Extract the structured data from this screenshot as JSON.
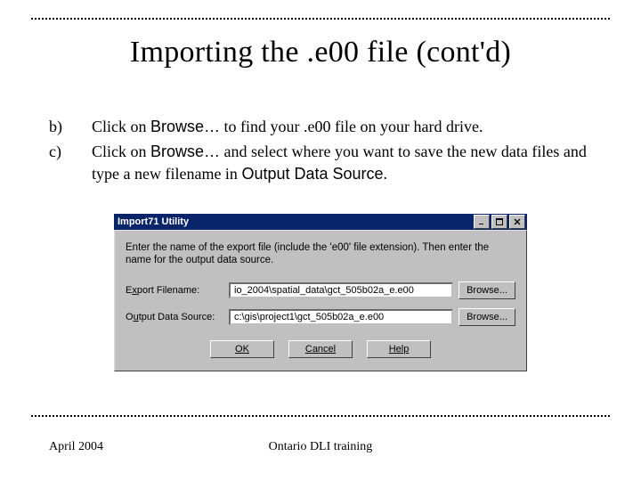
{
  "title": "Importing the .e00 file (cont'd)",
  "steps": {
    "b": {
      "letter": "b)",
      "pre": "Click on ",
      "cmd": "Browse…",
      "post": " to find your .e00 file on your hard drive."
    },
    "c": {
      "letter": "c)",
      "pre": "Click on ",
      "cmd": "Browse…",
      "mid": " and select where you want to save the new data files and type a new filename in ",
      "post_cmd": "Output Data Source",
      "end": "."
    }
  },
  "dialog": {
    "caption": "Import71 Utility",
    "instruction": "Enter the name of the export file (include the 'e00' file extension). Then enter the name for the output data source.",
    "fields": {
      "export": {
        "label_pre": "E",
        "label_hot": "x",
        "label_post": "port Filename:",
        "value": "io_2004\\spatial_data\\gct_505b02a_e.e00"
      },
      "output": {
        "label_pre": "O",
        "label_hot": "u",
        "label_post": "tput Data Source:",
        "value": "c:\\gis\\project1\\gct_505b02a_e.e00"
      }
    },
    "browse_label": "Browse...",
    "buttons": {
      "ok": "OK",
      "cancel": "Cancel",
      "help": "Help"
    }
  },
  "footer": {
    "left": "April 2004",
    "center": "Ontario DLI training"
  }
}
